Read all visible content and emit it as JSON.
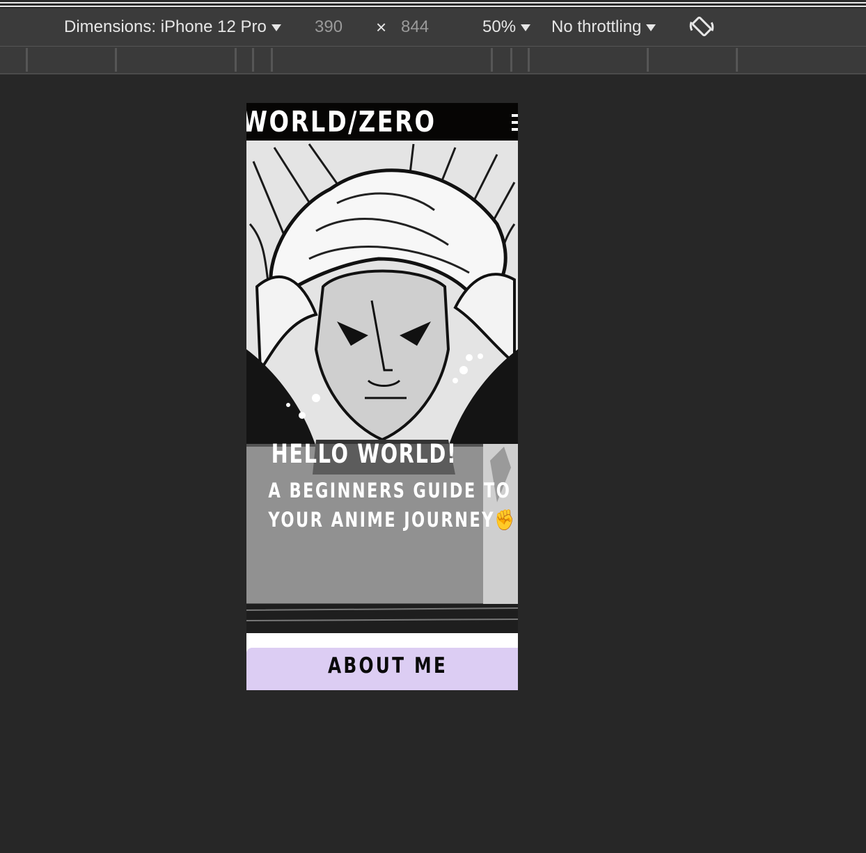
{
  "devtools": {
    "dimensions_label": "Dimensions: iPhone 12 Pro",
    "width": "390",
    "times": "×",
    "height": "844",
    "zoom": "50%",
    "throttling": "No throttling",
    "rotate_icon": "rotate-icon"
  },
  "site": {
    "logo": "WORLD/ZERO",
    "menu_icon": "hamburger-menu-icon",
    "hero": {
      "title": "HELLO WORLD!",
      "subtitle_line1": "A BEGINNERS GUIDE TO",
      "subtitle_line2": "YOUR ANIME JOURNEY✊"
    },
    "about_button": "ABOUT ME"
  },
  "colors": {
    "page_bg": "#272727",
    "toolbar_bg": "#3b3b3b",
    "header_bg": "#060504",
    "about_bg": "#dccdf3"
  }
}
